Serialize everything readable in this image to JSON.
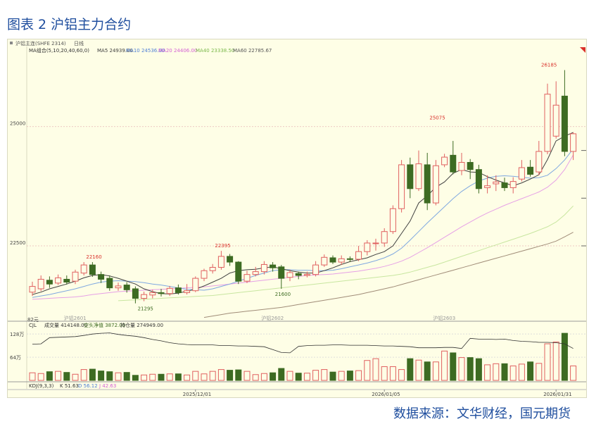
{
  "figure_title": "图表 2 沪铝主力合约",
  "source_text": "数据来源：文华财经，国元期货",
  "header": {
    "instrument": "沪铝主连(SHFE 2314)",
    "period": "日线",
    "ma_label": "MA组合(5,10,20,40,60,0)",
    "ma5": "MA5 24939.00",
    "ma10": "MA10 24536.00",
    "ma20": "MA20 24406.00",
    "ma40": "MA40 23338.50",
    "ma60": "MA60 22785.67"
  },
  "volume_header": {
    "cjl": "CJL",
    "volume": "成交量 414148.00",
    "open_interest_change": "空头净值 3872.00",
    "open_interest": "持仓量 274949.00"
  },
  "kdj_header": {
    "label": "KDJ(9,3,3)",
    "k": "K 51.63",
    "d": "D 56.12",
    "j": "J 42.63"
  },
  "contract_marks": [
    "沪铝2601",
    "沪铝2602",
    "沪铝2603"
  ],
  "colors": {
    "up": "#e06060",
    "down": "#3d6b22",
    "ma5": "#404040",
    "ma10": "#7fa8e0",
    "ma20": "#e6a0e6",
    "ma40": "#c8e6a0",
    "ma60": "#a08c78",
    "oi": "#303030",
    "title": "#1f4e9e"
  },
  "chart_data": {
    "type": "candlestick",
    "y_ticks": [
      "25000",
      "22500"
    ],
    "ylim": [
      20950,
      26650
    ],
    "x_tick_labels": [
      "2025/12/01",
      "2026/01/05",
      "2026/01/31"
    ],
    "annotations": [
      {
        "text": "22160",
        "index": 7,
        "value": 22160,
        "color": "#d9302a"
      },
      {
        "text": "21295",
        "index": 13,
        "value": 21295,
        "color": "#3d6b22"
      },
      {
        "text": "22395",
        "index": 22,
        "value": 22395,
        "color": "#d9302a"
      },
      {
        "text": "21600",
        "index": 29,
        "value": 21600,
        "color": "#3d6b22"
      },
      {
        "text": "25075",
        "index": 47,
        "value": 25075,
        "color": "#d9302a"
      },
      {
        "text": "26185",
        "index": 60,
        "value": 26185,
        "color": "#d9302a"
      }
    ],
    "volume_axis_labels": [
      "128万",
      "64万"
    ],
    "price_axis_extra_label": "82元",
    "candles": [
      {
        "o": 21530,
        "c": 21650,
        "h": 21750,
        "l": 21450
      },
      {
        "o": 21600,
        "c": 21800,
        "h": 21880,
        "l": 21550
      },
      {
        "o": 21780,
        "c": 21700,
        "h": 21860,
        "l": 21620
      },
      {
        "o": 21720,
        "c": 21830,
        "h": 21900,
        "l": 21680
      },
      {
        "o": 21800,
        "c": 21740,
        "h": 21880,
        "l": 21690
      },
      {
        "o": 21760,
        "c": 21950,
        "h": 22000,
        "l": 21700
      },
      {
        "o": 21930,
        "c": 22100,
        "h": 22160,
        "l": 21880
      },
      {
        "o": 22100,
        "c": 21900,
        "h": 22160,
        "l": 21850
      },
      {
        "o": 21900,
        "c": 21800,
        "h": 21960,
        "l": 21720
      },
      {
        "o": 21820,
        "c": 21620,
        "h": 21880,
        "l": 21560
      },
      {
        "o": 21620,
        "c": 21660,
        "h": 21730,
        "l": 21560
      },
      {
        "o": 21680,
        "c": 21580,
        "h": 21740,
        "l": 21520
      },
      {
        "o": 21600,
        "c": 21400,
        "h": 21650,
        "l": 21295
      },
      {
        "o": 21400,
        "c": 21480,
        "h": 21540,
        "l": 21340
      },
      {
        "o": 21470,
        "c": 21520,
        "h": 21580,
        "l": 21400
      },
      {
        "o": 21520,
        "c": 21500,
        "h": 21600,
        "l": 21440
      },
      {
        "o": 21500,
        "c": 21610,
        "h": 21660,
        "l": 21450
      },
      {
        "o": 21620,
        "c": 21520,
        "h": 21690,
        "l": 21480
      },
      {
        "o": 21520,
        "c": 21560,
        "h": 21700,
        "l": 21480
      },
      {
        "o": 21560,
        "c": 21820,
        "h": 21860,
        "l": 21530
      },
      {
        "o": 21820,
        "c": 21980,
        "h": 22020,
        "l": 21760
      },
      {
        "o": 21980,
        "c": 22050,
        "h": 22120,
        "l": 21920
      },
      {
        "o": 22050,
        "c": 22280,
        "h": 22395,
        "l": 22000
      },
      {
        "o": 22280,
        "c": 22160,
        "h": 22330,
        "l": 22080
      },
      {
        "o": 22160,
        "c": 21760,
        "h": 22180,
        "l": 21700
      },
      {
        "o": 21760,
        "c": 21900,
        "h": 21980,
        "l": 21720
      },
      {
        "o": 21900,
        "c": 21960,
        "h": 22060,
        "l": 21860
      },
      {
        "o": 21960,
        "c": 22110,
        "h": 22180,
        "l": 21900
      },
      {
        "o": 22100,
        "c": 22040,
        "h": 22160,
        "l": 21960
      },
      {
        "o": 22060,
        "c": 21820,
        "h": 22100,
        "l": 21600
      },
      {
        "o": 21840,
        "c": 21940,
        "h": 22000,
        "l": 21760
      },
      {
        "o": 21920,
        "c": 21880,
        "h": 21960,
        "l": 21800
      },
      {
        "o": 21880,
        "c": 21900,
        "h": 21960,
        "l": 21840
      },
      {
        "o": 21900,
        "c": 22100,
        "h": 22180,
        "l": 21860
      },
      {
        "o": 22100,
        "c": 22260,
        "h": 22320,
        "l": 22060
      },
      {
        "o": 22250,
        "c": 22160,
        "h": 22300,
        "l": 22120
      },
      {
        "o": 22160,
        "c": 22230,
        "h": 22300,
        "l": 22100
      },
      {
        "o": 22230,
        "c": 22220,
        "h": 22280,
        "l": 22160
      },
      {
        "o": 22220,
        "c": 22380,
        "h": 22500,
        "l": 22180
      },
      {
        "o": 22380,
        "c": 22560,
        "h": 22620,
        "l": 22300
      },
      {
        "o": 22560,
        "c": 22560,
        "h": 22650,
        "l": 22400
      },
      {
        "o": 22560,
        "c": 22800,
        "h": 22870,
        "l": 22480
      },
      {
        "o": 22800,
        "c": 23280,
        "h": 23350,
        "l": 22750
      },
      {
        "o": 23280,
        "c": 24200,
        "h": 24300,
        "l": 23200
      },
      {
        "o": 24200,
        "c": 23700,
        "h": 24350,
        "l": 23500
      },
      {
        "o": 23700,
        "c": 24220,
        "h": 24500,
        "l": 23650
      },
      {
        "o": 24200,
        "c": 23400,
        "h": 24450,
        "l": 23250
      },
      {
        "o": 23400,
        "c": 24180,
        "h": 24300,
        "l": 23350
      },
      {
        "o": 24200,
        "c": 24360,
        "h": 24430,
        "l": 24150
      },
      {
        "o": 24400,
        "c": 24050,
        "h": 24700,
        "l": 24000
      },
      {
        "o": 24080,
        "c": 24250,
        "h": 24450,
        "l": 23980
      },
      {
        "o": 24250,
        "c": 24100,
        "h": 24320,
        "l": 23900
      },
      {
        "o": 24100,
        "c": 23700,
        "h": 24200,
        "l": 23600
      },
      {
        "o": 23720,
        "c": 23760,
        "h": 23980,
        "l": 23600
      },
      {
        "o": 23800,
        "c": 23840,
        "h": 23980,
        "l": 23650
      },
      {
        "o": 23820,
        "c": 23720,
        "h": 23930,
        "l": 23650
      },
      {
        "o": 23720,
        "c": 23850,
        "h": 23940,
        "l": 23600
      },
      {
        "o": 23900,
        "c": 24140,
        "h": 24300,
        "l": 23850
      },
      {
        "o": 24150,
        "c": 24000,
        "h": 24300,
        "l": 23950
      },
      {
        "o": 24050,
        "c": 24480,
        "h": 24700,
        "l": 23980
      },
      {
        "o": 24480,
        "c": 25680,
        "h": 25900,
        "l": 24420
      },
      {
        "o": 24800,
        "c": 25450,
        "h": 25950,
        "l": 24750
      },
      {
        "o": 25640,
        "c": 24480,
        "h": 26185,
        "l": 24380
      },
      {
        "o": 24480,
        "c": 24850,
        "h": 24880,
        "l": 24300
      }
    ],
    "ma5": [
      21480,
      21530,
      21600,
      21650,
      21700,
      21760,
      21830,
      21880,
      21900,
      21870,
      21820,
      21760,
      21700,
      21600,
      21540,
      21500,
      21490,
      21510,
      21550,
      21590,
      21660,
      21740,
      21820,
      21930,
      21980,
      22000,
      22010,
      22040,
      22060,
      22020,
      21980,
      21950,
      21930,
      21930,
      21980,
      22040,
      22110,
      22170,
      22210,
      22250,
      22320,
      22380,
      22500,
      22760,
      23020,
      23400,
      23550,
      23730,
      23840,
      24020,
      24100,
      24050,
      24040,
      23950,
      23880,
      23820,
      23760,
      23820,
      23900,
      23990,
      24310,
      24700,
      24800,
      24880
    ],
    "ma10": [
      21420,
      21450,
      21480,
      21520,
      21560,
      21600,
      21650,
      21700,
      21740,
      21760,
      21770,
      21760,
      21750,
      21730,
      21700,
      21680,
      21650,
      21620,
      21590,
      21580,
      21570,
      21600,
      21650,
      21700,
      21760,
      21820,
      21880,
      21930,
      21980,
      22000,
      22000,
      21990,
      21990,
      21980,
      21980,
      21990,
      22020,
      22060,
      22100,
      22140,
      22190,
      22250,
      22330,
      22450,
      22620,
      22800,
      22980,
      23150,
      23320,
      23490,
      23640,
      23760,
      23860,
      23920,
      23960,
      23970,
      23960,
      23940,
      23920,
      23930,
      23980,
      24120,
      24300,
      24536
    ],
    "ma20": [
      21380,
      21390,
      21400,
      21410,
      21420,
      21430,
      21450,
      21480,
      21500,
      21520,
      21540,
      21550,
      21560,
      21570,
      21580,
      21590,
      21600,
      21610,
      21620,
      21630,
      21640,
      21660,
      21680,
      21700,
      21720,
      21740,
      21760,
      21780,
      21800,
      21820,
      21840,
      21860,
      21880,
      21890,
      21900,
      21910,
      21930,
      21950,
      21970,
      22000,
      22030,
      22070,
      22120,
      22180,
      22260,
      22360,
      22460,
      22570,
      22680,
      22790,
      22900,
      23000,
      23100,
      23190,
      23270,
      23350,
      23420,
      23490,
      23560,
      23630,
      23730,
      23880,
      24100,
      24406
    ],
    "ma40": [
      null,
      null,
      null,
      null,
      null,
      null,
      null,
      null,
      null,
      null,
      21350,
      21360,
      21370,
      21380,
      21390,
      21400,
      21410,
      21420,
      21430,
      21440,
      21450,
      21460,
      21480,
      21500,
      21520,
      21540,
      21560,
      21580,
      21600,
      21620,
      21640,
      21660,
      21680,
      21700,
      21720,
      21740,
      21760,
      21780,
      21800,
      21820,
      21840,
      21860,
      21880,
      21910,
      21950,
      22000,
      22050,
      22100,
      22160,
      22220,
      22280,
      22340,
      22400,
      22460,
      22520,
      22580,
      22640,
      22700,
      22760,
      22830,
      22900,
      23000,
      23150,
      23338
    ],
    "ma60": [
      null,
      null,
      null,
      null,
      null,
      null,
      null,
      null,
      null,
      null,
      null,
      null,
      null,
      null,
      null,
      null,
      null,
      null,
      null,
      null,
      21000,
      21030,
      21060,
      21090,
      21110,
      21130,
      21150,
      21170,
      21190,
      21210,
      21240,
      21270,
      21300,
      21330,
      21360,
      21390,
      21420,
      21450,
      21480,
      21520,
      21560,
      21600,
      21640,
      21690,
      21740,
      21790,
      21840,
      21890,
      21940,
      21990,
      22040,
      22090,
      22140,
      22190,
      22240,
      22290,
      22340,
      22390,
      22440,
      22490,
      22540,
      22600,
      22690,
      22785
    ],
    "volume_ylim": [
      0,
      1400000
    ],
    "volume": [
      210000,
      190000,
      240000,
      250000,
      220000,
      170000,
      300000,
      310000,
      260000,
      240000,
      210000,
      220000,
      140000,
      150000,
      170000,
      170000,
      180000,
      180000,
      150000,
      250000,
      180000,
      250000,
      300000,
      280000,
      290000,
      250000,
      160000,
      190000,
      210000,
      330000,
      250000,
      200000,
      200000,
      280000,
      300000,
      230000,
      250000,
      260000,
      270000,
      550000,
      600000,
      380000,
      380000,
      300000,
      600000,
      560000,
      510000,
      510000,
      810000,
      760000,
      630000,
      630000,
      600000,
      430000,
      460000,
      460000,
      400000,
      450000,
      510000,
      470000,
      1010000,
      1060000,
      1300000,
      400000
    ],
    "open_interest": [
      1000000,
      1010000,
      1180000,
      1190000,
      1200000,
      1210000,
      1240000,
      1280000,
      1300000,
      1310000,
      1270000,
      1240000,
      1220000,
      1180000,
      1130000,
      1090000,
      1040000,
      1010000,
      990000,
      980000,
      980000,
      980000,
      960000,
      960000,
      950000,
      950000,
      940000,
      930000,
      850000,
      770000,
      760000,
      940000,
      960000,
      970000,
      970000,
      980000,
      980000,
      970000,
      970000,
      970000,
      960000,
      950000,
      950000,
      940000,
      930000,
      900000,
      900000,
      900000,
      910000,
      910000,
      880000,
      1160000,
      1140000,
      1140000,
      1130000,
      1140000,
      1100000,
      1080000,
      1070000,
      1050000,
      1050000,
      1040000,
      1010000,
      880000
    ]
  }
}
